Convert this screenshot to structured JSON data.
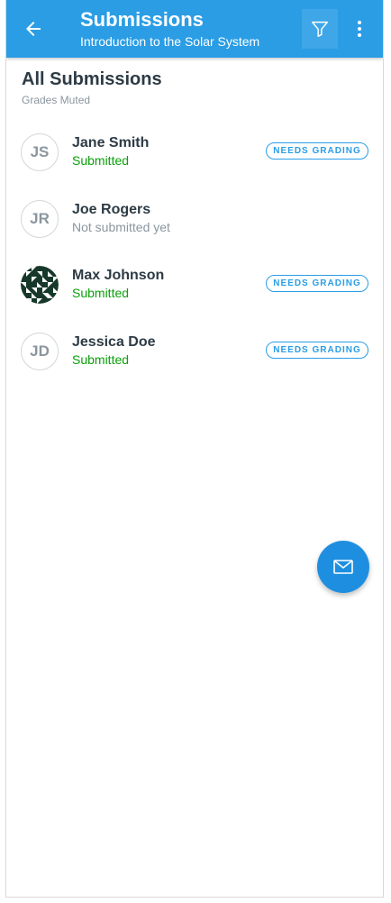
{
  "toolbar": {
    "title": "Submissions",
    "subtitle": "Introduction to the Solar System",
    "back_icon": "arrow-left-icon",
    "filter_icon": "filter-icon",
    "more_icon": "more-vert-icon",
    "color": "#2a9de5"
  },
  "header": {
    "title": "All Submissions",
    "subtitle": "Grades Muted"
  },
  "submissions": [
    {
      "initials": "JS",
      "name": "Jane Smith",
      "status": "Submitted",
      "badge": "NEEDS GRADING",
      "avatar_type": "initials"
    },
    {
      "initials": "JR",
      "name": "Joe Rogers",
      "status": "Not submitted yet",
      "badge": "",
      "avatar_type": "initials"
    },
    {
      "initials": "",
      "name": "Max Johnson",
      "status": "Submitted",
      "badge": "NEEDS GRADING",
      "avatar_type": "pattern"
    },
    {
      "initials": "JD",
      "name": "Jessica Doe",
      "status": "Submitted",
      "badge": "NEEDS GRADING",
      "avatar_type": "initials"
    }
  ],
  "fab": {
    "icon": "mail-icon"
  },
  "colors": {
    "accent": "#2a9de5",
    "submitted": "#0aa00a",
    "muted": "#8b969e",
    "text": "#2d3b45"
  }
}
